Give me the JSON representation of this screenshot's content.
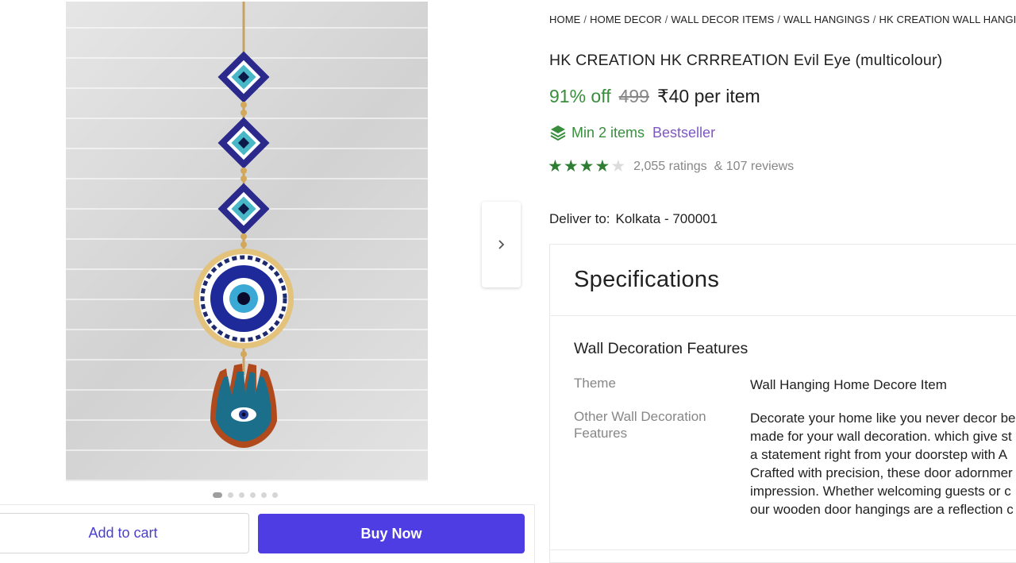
{
  "breadcrumb": {
    "items": [
      "HOME",
      "HOME DECOR",
      "WALL DECOR ITEMS",
      "WALL HANGINGS",
      "HK CREATION WALL HANGINGS"
    ],
    "separator": "/"
  },
  "product": {
    "title": "HK CREATION HK CRRREATION Evil Eye (multicolour)",
    "discount": "91% off",
    "mrp": "499",
    "price": "₹40 per item",
    "min_items": "Min 2 items",
    "badge": "Bestseller",
    "rating": 4,
    "rating_max": 5,
    "ratings_count": "2,055 ratings",
    "reviews_count": "& 107 reviews"
  },
  "gallery": {
    "image_count": 6,
    "active_index": 0
  },
  "delivery": {
    "label": "Deliver to:",
    "location": "Kolkata - 700001"
  },
  "actions": {
    "add_to_cart": "Add to cart",
    "buy_now": "Buy Now"
  },
  "specifications": {
    "heading": "Specifications",
    "section": "Wall Decoration Features",
    "rows": [
      {
        "label": "Theme",
        "value": "Wall Hanging Home Decore Item"
      },
      {
        "label": "Other Wall Decoration Features",
        "value_lines": [
          "Decorate your home like you never decor be",
          "made for your wall decoration. which give st",
          "a statement right from your doorstep with A",
          "Crafted with precision, these door adornmer",
          "impression. Whether welcoming guests or c",
          "our wooden door hangings are a reflection c"
        ]
      }
    ]
  },
  "colors": {
    "accent": "#4e3de2",
    "discount_green": "#388e3c",
    "star_green": "#2e7d32",
    "bestseller_purple": "#7e57c2",
    "muted": "#878787"
  }
}
